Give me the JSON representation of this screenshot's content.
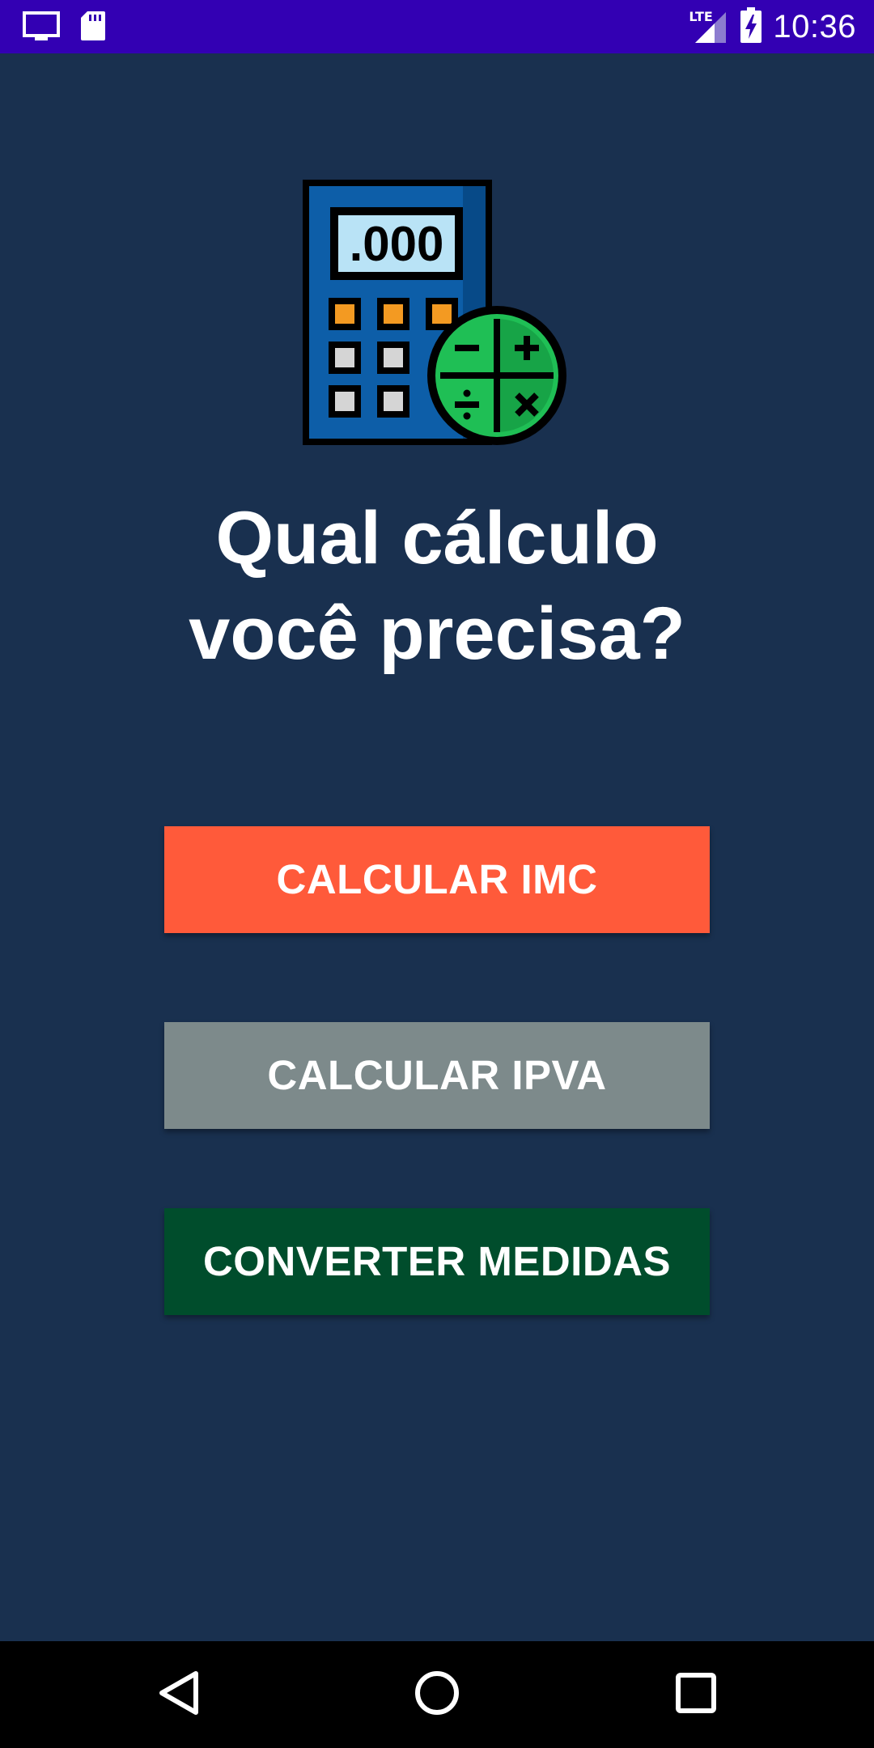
{
  "status_bar": {
    "time": "10:36",
    "network": "LTE",
    "icons": [
      "screen-cast-icon",
      "sd-card-icon",
      "lte-signal-icon",
      "battery-charging-icon"
    ],
    "background": "#3300b3"
  },
  "main": {
    "background": "#19304f",
    "illustration": {
      "icon": "calculator-icon",
      "display_text": ".000"
    },
    "title": "Qual cálculo\nvocê precisa?",
    "buttons": [
      {
        "label": "CALCULAR IMC",
        "color": "#ff5a3a"
      },
      {
        "label": "CALCULAR IPVA",
        "color": "#7d8a8b"
      },
      {
        "label": "CONVERTER MEDIDAS",
        "color": "#004d2c"
      }
    ]
  },
  "nav_bar": {
    "icons": [
      "back-triangle-icon",
      "home-circle-icon",
      "recents-square-icon"
    ]
  }
}
